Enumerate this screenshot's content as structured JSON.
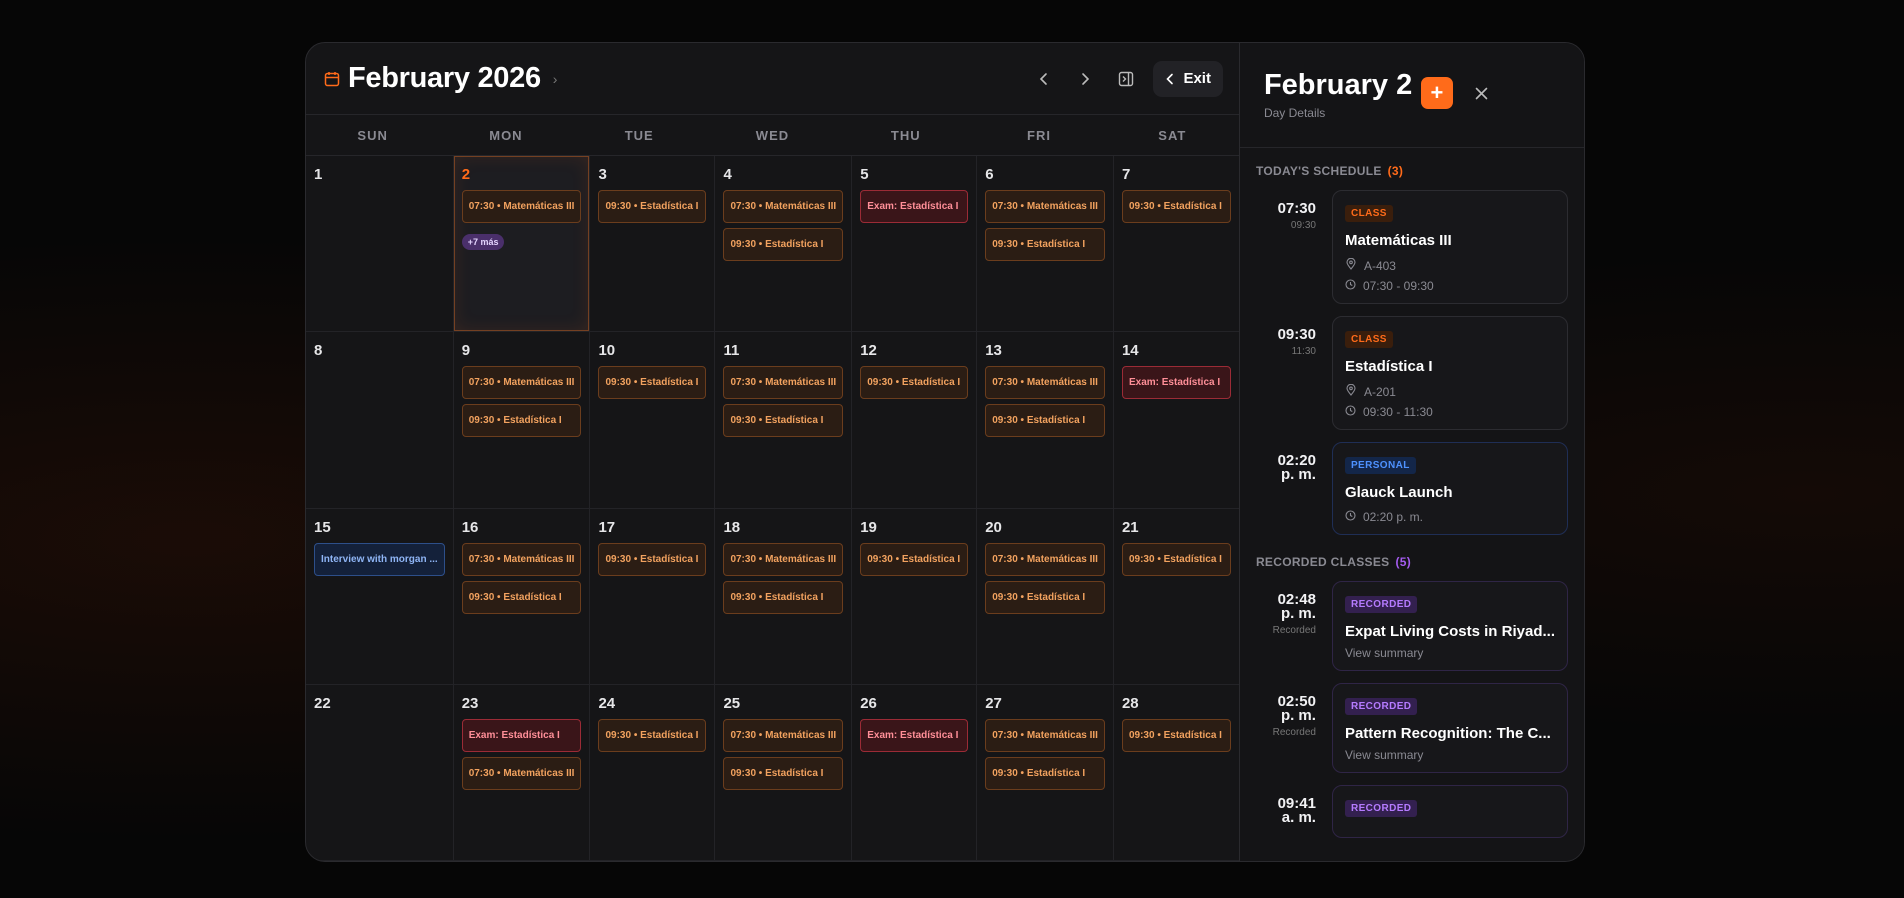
{
  "calendar": {
    "title": "February 2026",
    "exit_label": "Exit",
    "days_of_week": [
      "SUN",
      "MON",
      "TUE",
      "WED",
      "THU",
      "FRI",
      "SAT"
    ],
    "cells": [
      {
        "day": "1",
        "events": []
      },
      {
        "day": "2",
        "today": true,
        "events": [
          {
            "type": "class",
            "label": "07:30 • Matemáticas III"
          }
        ],
        "more": "+7 más"
      },
      {
        "day": "3",
        "events": [
          {
            "type": "class",
            "label": "09:30 • Estadística I"
          }
        ]
      },
      {
        "day": "4",
        "events": [
          {
            "type": "class",
            "label": "07:30 • Matemáticas III"
          },
          {
            "type": "class",
            "label": "09:30 • Estadística I"
          }
        ]
      },
      {
        "day": "5",
        "events": [
          {
            "type": "exam",
            "label": "Exam: Estadística I"
          }
        ]
      },
      {
        "day": "6",
        "events": [
          {
            "type": "class",
            "label": "07:30 • Matemáticas III"
          },
          {
            "type": "class",
            "label": "09:30 • Estadística I"
          }
        ]
      },
      {
        "day": "7",
        "events": [
          {
            "type": "class",
            "label": "09:30 • Estadística I"
          }
        ]
      },
      {
        "day": "8",
        "events": []
      },
      {
        "day": "9",
        "events": [
          {
            "type": "class",
            "label": "07:30 • Matemáticas III"
          },
          {
            "type": "class",
            "label": "09:30 • Estadística I"
          }
        ]
      },
      {
        "day": "10",
        "events": [
          {
            "type": "class",
            "label": "09:30 • Estadística I"
          }
        ]
      },
      {
        "day": "11",
        "events": [
          {
            "type": "class",
            "label": "07:30 • Matemáticas III"
          },
          {
            "type": "class",
            "label": "09:30 • Estadística I"
          }
        ]
      },
      {
        "day": "12",
        "events": [
          {
            "type": "class",
            "label": "09:30 • Estadística I"
          }
        ]
      },
      {
        "day": "13",
        "events": [
          {
            "type": "class",
            "label": "07:30 • Matemáticas III"
          },
          {
            "type": "class",
            "label": "09:30 • Estadística I"
          }
        ]
      },
      {
        "day": "14",
        "events": [
          {
            "type": "exam",
            "label": "Exam: Estadística I"
          }
        ]
      },
      {
        "day": "15",
        "events": [
          {
            "type": "personal",
            "label": "Interview with morgan ..."
          }
        ]
      },
      {
        "day": "16",
        "events": [
          {
            "type": "class",
            "label": "07:30 • Matemáticas III"
          },
          {
            "type": "class",
            "label": "09:30 • Estadística I"
          }
        ]
      },
      {
        "day": "17",
        "events": [
          {
            "type": "class",
            "label": "09:30 • Estadística I"
          }
        ]
      },
      {
        "day": "18",
        "events": [
          {
            "type": "class",
            "label": "07:30 • Matemáticas III"
          },
          {
            "type": "class",
            "label": "09:30 • Estadística I"
          }
        ]
      },
      {
        "day": "19",
        "events": [
          {
            "type": "class",
            "label": "09:30 • Estadística I"
          }
        ]
      },
      {
        "day": "20",
        "events": [
          {
            "type": "class",
            "label": "07:30 • Matemáticas III"
          },
          {
            "type": "class",
            "label": "09:30 • Estadística I"
          }
        ]
      },
      {
        "day": "21",
        "events": [
          {
            "type": "class",
            "label": "09:30 • Estadística I"
          }
        ]
      },
      {
        "day": "22",
        "events": []
      },
      {
        "day": "23",
        "events": [
          {
            "type": "exam",
            "label": "Exam: Estadística I"
          },
          {
            "type": "class",
            "label": "07:30 • Matemáticas III"
          }
        ]
      },
      {
        "day": "24",
        "events": [
          {
            "type": "class",
            "label": "09:30 • Estadística I"
          }
        ]
      },
      {
        "day": "25",
        "events": [
          {
            "type": "class",
            "label": "07:30 • Matemáticas III"
          },
          {
            "type": "class",
            "label": "09:30 • Estadística I"
          }
        ]
      },
      {
        "day": "26",
        "events": [
          {
            "type": "exam",
            "label": "Exam: Estadística I"
          }
        ]
      },
      {
        "day": "27",
        "events": [
          {
            "type": "class",
            "label": "07:30 • Matemáticas III"
          },
          {
            "type": "class",
            "label": "09:30 • Estadística I"
          }
        ]
      },
      {
        "day": "28",
        "events": [
          {
            "type": "class",
            "label": "09:30 • Estadística I"
          }
        ]
      }
    ]
  },
  "panel": {
    "title": "February 2",
    "subtitle": "Day Details",
    "add_label": "+",
    "schedule_title": "TODAY'S SCHEDULE",
    "schedule_count": "(3)",
    "schedule": [
      {
        "time": "07:30",
        "time_sub": "09:30",
        "badge": "CLASS",
        "kind": "class",
        "title": "Matemáticas III",
        "location": "A-403",
        "range": "07:30 - 09:30"
      },
      {
        "time": "09:30",
        "time_sub": "11:30",
        "badge": "CLASS",
        "kind": "class",
        "title": "Estadística I",
        "location": "A-201",
        "range": "09:30 - 11:30"
      },
      {
        "time": "02:20\np. m.",
        "time_sub": "",
        "badge": "PERSONAL",
        "kind": "personal",
        "title": "Glauck Launch",
        "location": "",
        "range": "02:20 p. m."
      }
    ],
    "recorded_title": "RECORDED CLASSES",
    "recorded_count": "(5)",
    "recorded": [
      {
        "time": "02:48\np. m.",
        "time_sub": "Recorded",
        "badge": "RECORDED",
        "title": "Expat Living Costs in Riyad...",
        "link": "View summary"
      },
      {
        "time": "02:50\np. m.",
        "time_sub": "Recorded",
        "badge": "RECORDED",
        "title": "Pattern Recognition: The C...",
        "link": "View summary"
      },
      {
        "time": "09:41\na. m.",
        "time_sub": "",
        "badge": "RECORDED",
        "title": "",
        "link": ""
      }
    ]
  }
}
